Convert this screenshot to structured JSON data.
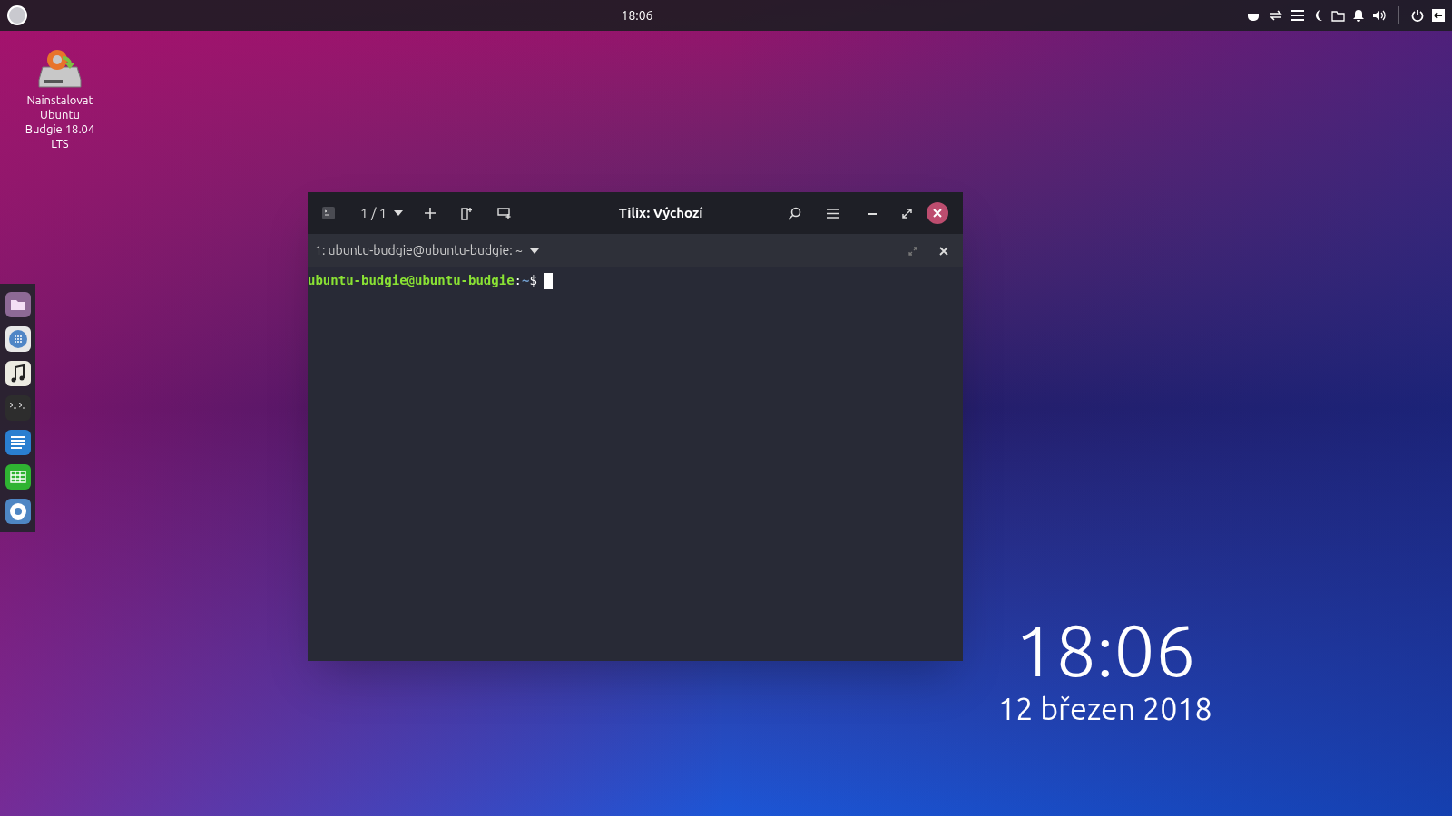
{
  "top_panel": {
    "clock": "18:06"
  },
  "desktop_icons": [
    {
      "label": "Nainstalovat Ubuntu Budgie 18.04 LTS"
    }
  ],
  "terminal": {
    "title": "Tilix: Výchozí",
    "session_counter": "1 / 1",
    "tab_title": "1: ubuntu-budgie@ubuntu-budgie: ~",
    "prompt": {
      "user_host": "ubuntu-budgie@ubuntu-budgie",
      "separator": ":",
      "path": "~",
      "symbol": "$"
    }
  },
  "desktop_clock": {
    "time": "18:06",
    "date": "12 březen 2018"
  }
}
